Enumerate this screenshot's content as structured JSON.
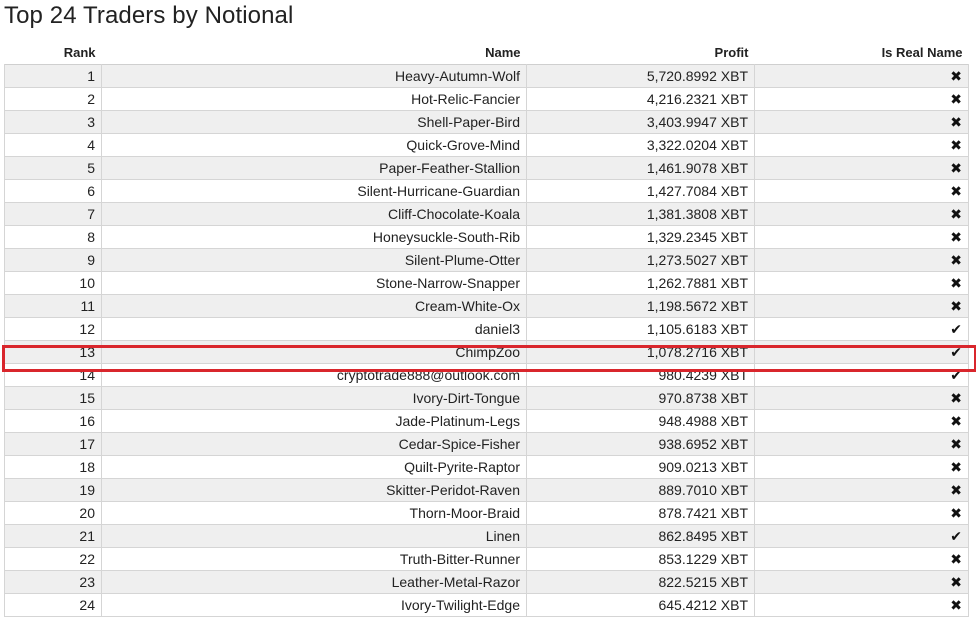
{
  "title": "Top 24 Traders by Notional",
  "columns": {
    "rank": "Rank",
    "name": "Name",
    "profit": "Profit",
    "is_real_name": "Is Real Name"
  },
  "icons": {
    "no": "✖",
    "yes": "✔"
  },
  "highlighted_rank": 13,
  "highlight_color": "#d9262c",
  "rows": [
    {
      "rank": "1",
      "name": "Heavy-Autumn-Wolf",
      "profit": "5,720.8992 XBT",
      "real": "no"
    },
    {
      "rank": "2",
      "name": "Hot-Relic-Fancier",
      "profit": "4,216.2321 XBT",
      "real": "no"
    },
    {
      "rank": "3",
      "name": "Shell-Paper-Bird",
      "profit": "3,403.9947 XBT",
      "real": "no"
    },
    {
      "rank": "4",
      "name": "Quick-Grove-Mind",
      "profit": "3,322.0204 XBT",
      "real": "no"
    },
    {
      "rank": "5",
      "name": "Paper-Feather-Stallion",
      "profit": "1,461.9078 XBT",
      "real": "no"
    },
    {
      "rank": "6",
      "name": "Silent-Hurricane-Guardian",
      "profit": "1,427.7084 XBT",
      "real": "no"
    },
    {
      "rank": "7",
      "name": "Cliff-Chocolate-Koala",
      "profit": "1,381.3808 XBT",
      "real": "no"
    },
    {
      "rank": "8",
      "name": "Honeysuckle-South-Rib",
      "profit": "1,329.2345 XBT",
      "real": "no"
    },
    {
      "rank": "9",
      "name": "Silent-Plume-Otter",
      "profit": "1,273.5027 XBT",
      "real": "no"
    },
    {
      "rank": "10",
      "name": "Stone-Narrow-Snapper",
      "profit": "1,262.7881 XBT",
      "real": "no"
    },
    {
      "rank": "11",
      "name": "Cream-White-Ox",
      "profit": "1,198.5672 XBT",
      "real": "no"
    },
    {
      "rank": "12",
      "name": "daniel3",
      "profit": "1,105.6183 XBT",
      "real": "yes"
    },
    {
      "rank": "13",
      "name": "ChimpZoo",
      "profit": "1,078.2716 XBT",
      "real": "yes"
    },
    {
      "rank": "14",
      "name": "cryptotrade888@outlook.com",
      "profit": "980.4239 XBT",
      "real": "yes"
    },
    {
      "rank": "15",
      "name": "Ivory-Dirt-Tongue",
      "profit": "970.8738 XBT",
      "real": "no"
    },
    {
      "rank": "16",
      "name": "Jade-Platinum-Legs",
      "profit": "948.4988 XBT",
      "real": "no"
    },
    {
      "rank": "17",
      "name": "Cedar-Spice-Fisher",
      "profit": "938.6952 XBT",
      "real": "no"
    },
    {
      "rank": "18",
      "name": "Quilt-Pyrite-Raptor",
      "profit": "909.0213 XBT",
      "real": "no"
    },
    {
      "rank": "19",
      "name": "Skitter-Peridot-Raven",
      "profit": "889.7010 XBT",
      "real": "no"
    },
    {
      "rank": "20",
      "name": "Thorn-Moor-Braid",
      "profit": "878.7421 XBT",
      "real": "no"
    },
    {
      "rank": "21",
      "name": "Linen",
      "profit": "862.8495 XBT",
      "real": "yes"
    },
    {
      "rank": "22",
      "name": "Truth-Bitter-Runner",
      "profit": "853.1229 XBT",
      "real": "no"
    },
    {
      "rank": "23",
      "name": "Leather-Metal-Razor",
      "profit": "822.5215 XBT",
      "real": "no"
    },
    {
      "rank": "24",
      "name": "Ivory-Twilight-Edge",
      "profit": "645.4212 XBT",
      "real": "no"
    }
  ]
}
